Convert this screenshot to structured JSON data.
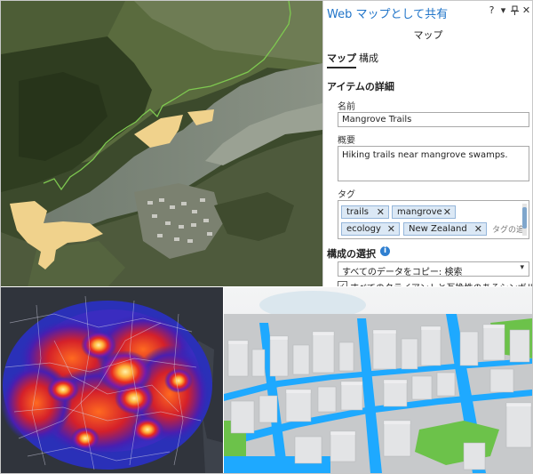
{
  "pane": {
    "title": "Web マップとして共有",
    "controls": {
      "help": "?",
      "menu": "▾",
      "pin": "ᵎ",
      "close": "✕"
    },
    "subtitle": "マップ",
    "tabs": [
      {
        "label": "マップ",
        "active": true
      },
      {
        "label": "構成",
        "active": false
      }
    ],
    "item_details": {
      "heading": "アイテムの詳細",
      "name_label": "名前",
      "name_value": "Mangrove Trails",
      "summary_label": "概要",
      "summary_value": "Hiking trails near mangrove swamps.",
      "tags_label": "タグ",
      "tags": [
        "trails",
        "mangrove",
        "ecology",
        "New Zealand"
      ],
      "tag_remove_glyph": "✕",
      "tags_placeholder": "タグの追"
    },
    "configuration": {
      "heading": "構成の選択",
      "info_glyph": "i",
      "select_value": "すべてのデータをコピー: 検索",
      "select_arrow": "▾",
      "checkbox_checked": true,
      "checkbox_glyph": "✓",
      "checkbox_label": "すべてのクライアントと互換性のあるシンボル タイプを使用"
    }
  },
  "colors": {
    "accent": "#1e73c8",
    "trail_line": "#7ec850",
    "sand": "#f0d28c",
    "water_3d": "#1ea9ff",
    "vegetation_3d": "#6cc24a"
  },
  "maps": [
    {
      "name": "satellite-imagery-map"
    },
    {
      "name": "heatmap-map"
    },
    {
      "name": "3d-city-scene"
    }
  ]
}
